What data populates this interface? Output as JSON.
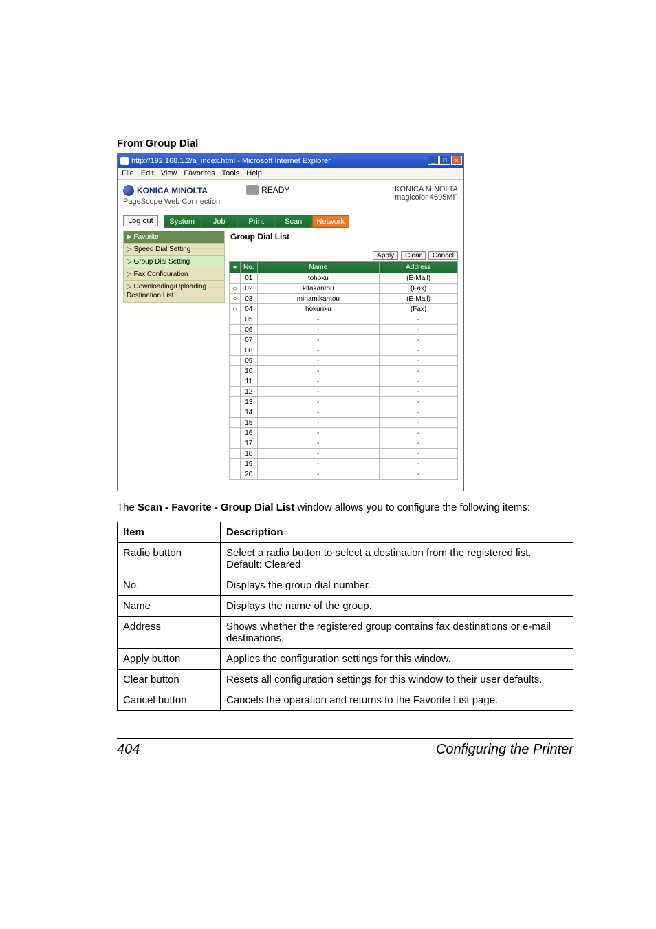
{
  "heading": "From Group Dial",
  "browser": {
    "title": "http://192.168.1.2/a_index.html - Microsoft Internet Explorer",
    "win_min": "_",
    "win_max": "□",
    "win_close": "×",
    "menu": {
      "file": "File",
      "edit": "Edit",
      "view": "View",
      "favorites": "Favorites",
      "tools": "Tools",
      "help": "Help"
    }
  },
  "header": {
    "brand": "KONICA MINOLTA",
    "psline": "PageScope Web Connection",
    "status": "READY",
    "right1": "KONICA MINOLTA",
    "right2": "magicolor 4695MF"
  },
  "logout": "Log out",
  "tabs": {
    "system": "System",
    "job": "Job",
    "print": "Print",
    "scan": "Scan",
    "network": "Network"
  },
  "sidebar": {
    "favorite": "▶ Favorite",
    "speed": "▷ Speed Dial Setting",
    "group": "▷ Group Dial Setting",
    "fax": "▷ Fax Configuration",
    "down": "▷ Downloading/Uploading Destination List"
  },
  "panel_title": "Group Dial List",
  "btns": {
    "apply": "Apply",
    "clear": "Clear",
    "cancel": "Cancel"
  },
  "th": {
    "radio": "●",
    "no": "No.",
    "name": "Name",
    "address": "Address"
  },
  "rows": [
    {
      "radio": "",
      "no": "01",
      "name": "tohoku",
      "address": "(E-Mail)"
    },
    {
      "radio": "○",
      "no": "02",
      "name": "kitakantou",
      "address": "(Fax)"
    },
    {
      "radio": "○",
      "no": "03",
      "name": "minamikantou",
      "address": "(E-Mail)"
    },
    {
      "radio": "○",
      "no": "04",
      "name": "hokuriku",
      "address": "(Fax)"
    },
    {
      "radio": "",
      "no": "05",
      "name": "-",
      "address": "-"
    },
    {
      "radio": "",
      "no": "06",
      "name": "-",
      "address": "-"
    },
    {
      "radio": "",
      "no": "07",
      "name": "-",
      "address": "-"
    },
    {
      "radio": "",
      "no": "08",
      "name": "-",
      "address": "-"
    },
    {
      "radio": "",
      "no": "09",
      "name": "-",
      "address": "-"
    },
    {
      "radio": "",
      "no": "10",
      "name": "-",
      "address": "-"
    },
    {
      "radio": "",
      "no": "11",
      "name": "-",
      "address": "-"
    },
    {
      "radio": "",
      "no": "12",
      "name": "-",
      "address": "-"
    },
    {
      "radio": "",
      "no": "13",
      "name": "-",
      "address": "-"
    },
    {
      "radio": "",
      "no": "14",
      "name": "-",
      "address": "-"
    },
    {
      "radio": "",
      "no": "15",
      "name": "-",
      "address": "-"
    },
    {
      "radio": "",
      "no": "16",
      "name": "-",
      "address": "-"
    },
    {
      "radio": "",
      "no": "17",
      "name": "-",
      "address": "-"
    },
    {
      "radio": "",
      "no": "18",
      "name": "-",
      "address": "-"
    },
    {
      "radio": "",
      "no": "19",
      "name": "-",
      "address": "-"
    },
    {
      "radio": "",
      "no": "20",
      "name": "-",
      "address": "-"
    }
  ],
  "caption_pre": "The ",
  "caption_bold": "Scan - Favorite - Group Dial List",
  "caption_post": " window allows you to configure the following items:",
  "desc_th1": "Item",
  "desc_th2": "Description",
  "desc_rows": [
    {
      "item": "Radio button",
      "desc": "Select a radio button to select a destination from the registered list.\nDefault: Cleared"
    },
    {
      "item": "No.",
      "desc": "Displays the group dial number."
    },
    {
      "item": "Name",
      "desc": "Displays the name of the group."
    },
    {
      "item": "Address",
      "desc": "Shows whether the registered group contains fax destinations or e-mail destinations."
    },
    {
      "item": "Apply button",
      "desc": "Applies the configuration settings for this window."
    },
    {
      "item": "Clear button",
      "desc": "Resets all configuration settings for this window to their user defaults."
    },
    {
      "item": "Cancel button",
      "desc": "Cancels the operation and returns to the Favorite List page."
    }
  ],
  "page_num": "404",
  "footer_title": "Configuring the Printer"
}
